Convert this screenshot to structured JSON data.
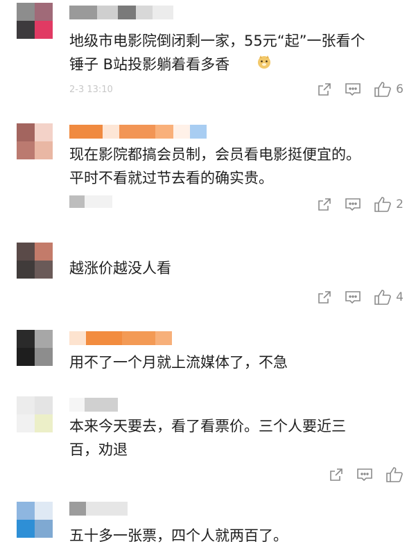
{
  "comments": [
    {
      "text": "地级市电影院倒闭剩一家，55元“起”一张看个\n锤子 B站投影躺着看多香",
      "time": "2-3 13:10",
      "like_count": "6"
    },
    {
      "text": "现在影院都搞会员制，会员看电影挺便宜的。\n平时不看就过节去看的确实贵。",
      "like_count": "2"
    },
    {
      "text": "越涨价越没人看",
      "like_count": "4"
    },
    {
      "text": "用不了一个月就上流媒体了，不急",
      "like_count": ""
    },
    {
      "text": "本来今天要去，看了看票价。三个人要近三\n百，劝退",
      "like_count": ""
    },
    {
      "text": "五十多一张票，四个人就两百了。",
      "like_count": ""
    }
  ],
  "icons": {
    "share": "share-icon",
    "reply": "comment-icon",
    "like": "thumbs-up-icon",
    "emoji": "doge-emoji-icon"
  }
}
